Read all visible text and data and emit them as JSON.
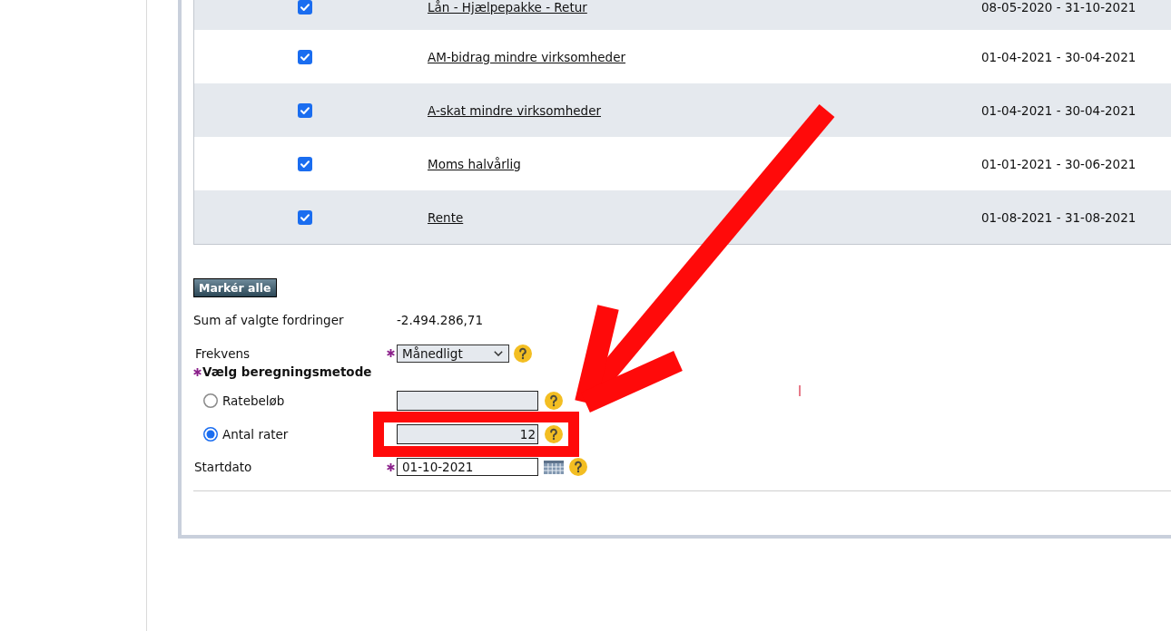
{
  "claims_table": {
    "rows": [
      {
        "checked": true,
        "name": "Lån - Hjælpepakke - Retur",
        "period": "08-05-2020 - 31-10-2021"
      },
      {
        "checked": true,
        "name": "AM-bidrag mindre virksomheder",
        "period": "01-04-2021 - 30-04-2021"
      },
      {
        "checked": true,
        "name": "A-skat mindre virksomheder",
        "period": "01-04-2021 - 30-04-2021"
      },
      {
        "checked": true,
        "name": "Moms halvårlig",
        "period": "01-01-2021 - 30-06-2021"
      },
      {
        "checked": true,
        "name": "Rente",
        "period": "01-08-2021 - 31-08-2021"
      }
    ]
  },
  "mark_all_button": {
    "label": "Markér alle"
  },
  "sum": {
    "label": "Sum af valgte fordringer",
    "value": "-2.494.286,71"
  },
  "frequency": {
    "label": "Frekvens",
    "required": true,
    "value": "Månedligt"
  },
  "calc_method": {
    "label": "Vælg beregningsmetode",
    "required": true,
    "options": [
      {
        "label": "Ratebeløb",
        "selected": false
      },
      {
        "label": "Antal rater",
        "selected": true,
        "value": "12"
      }
    ]
  },
  "start_date": {
    "label": "Startdato",
    "required": true,
    "value": "01-10-2021"
  }
}
